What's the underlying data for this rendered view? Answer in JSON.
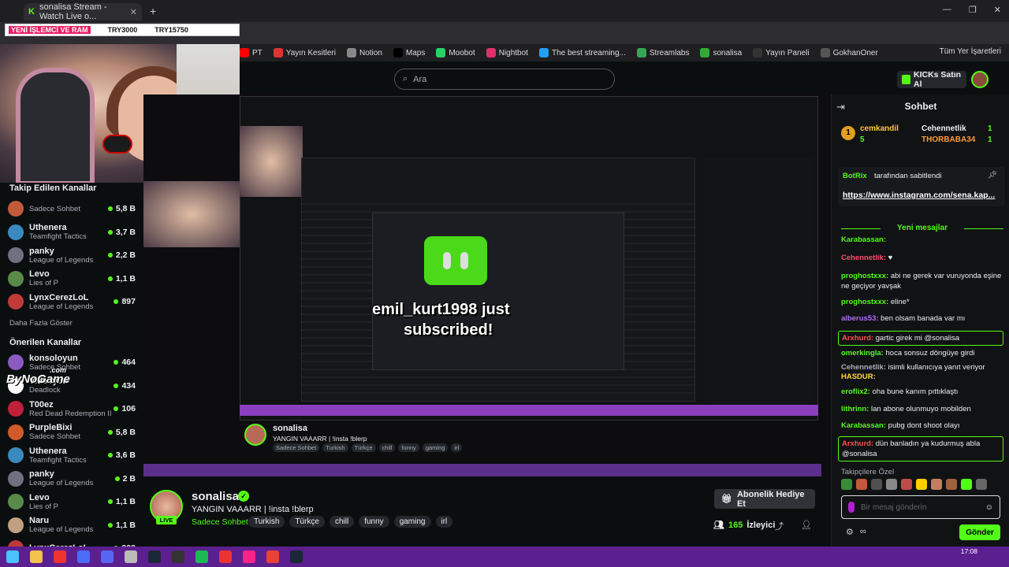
{
  "browser": {
    "tab_title": "sonalisa Stream - Watch Live o...",
    "search_placeholder": "Ara",
    "bookmarks": [
      "PT",
      "Yayın Kesitleri",
      "Notion",
      "Maps",
      "Moobot",
      "Nightbot",
      "The best streaming...",
      "Streamlabs",
      "sonalisa",
      "Yayın Paneli",
      "GokhanOner"
    ],
    "bookmarks_right": "Tüm Yer İşaretleri"
  },
  "overlay": {
    "ticker_highlight": "YENİ İŞLEMCİ VE RAM",
    "ticker_a": "TRY3000",
    "ticker_b": "TRY15750",
    "watermark": "ByNoGame",
    "watermark_small": ".com"
  },
  "header": {
    "ai_button": "KICKs Satın Al"
  },
  "sidebar": {
    "followed_header": "Takip Edilen Kanallar",
    "followed": [
      {
        "name": "",
        "game": "Sadece Sohbet",
        "viewers": "5,8 B",
        "color": "#c05a3a"
      },
      {
        "name": "Uthenera",
        "game": "Teamfight Tactics",
        "viewers": "3,7 B",
        "color": "#3a8ac0"
      },
      {
        "name": "panky",
        "game": "League of Legends",
        "viewers": "2,2 B",
        "color": "#707080"
      },
      {
        "name": "Levo",
        "game": "Lies of P",
        "viewers": "1,1 B",
        "color": "#5a8a4a"
      },
      {
        "name": "LynxCerezLoL",
        "game": "League of Legends",
        "viewers": "897",
        "color": "#c03a3a"
      }
    ],
    "more_link": "Daha Fazla Göster",
    "recommended_header": "Önerilen Kanallar",
    "recommended": [
      {
        "name": "konsoloyun",
        "game": "Sadece Sohbet",
        "viewers": "464",
        "color": "#8a5ac0"
      },
      {
        "name": "Videoyun",
        "game": "Deadlock",
        "viewers": "434",
        "color": "#ffffff"
      },
      {
        "name": "T00ez",
        "game": "Red Dead Redemption II",
        "viewers": "106",
        "color": "#c0203a"
      },
      {
        "name": "PurpleBixi",
        "game": "Sadece Sohbet",
        "viewers": "5,8 B",
        "color": "#d05a2a"
      },
      {
        "name": "Uthenera",
        "game": "Teamfight Tactics",
        "viewers": "3,6 B",
        "color": "#3a8ac0"
      },
      {
        "name": "panky",
        "game": "League of Legends",
        "viewers": "2 B",
        "color": "#707080"
      },
      {
        "name": "Levo",
        "game": "Lies of P",
        "viewers": "1,1 B",
        "color": "#5a8a4a"
      },
      {
        "name": "Naru",
        "game": "League of Legends",
        "viewers": "1,1 B",
        "color": "#c0a080"
      },
      {
        "name": "LynxCerezLoL",
        "game": "",
        "viewers": "903",
        "color": "#c03a3a"
      }
    ]
  },
  "player": {
    "sub_name": "emil_kurt1998 just",
    "sub_text": "subscribed!",
    "inner_name": "sonalisa",
    "inner_title": "YANGIN VAAARR | !insta !blerp",
    "inner_tags": [
      "Sadece Sohbet",
      "Turkish",
      "Türkçe",
      "chill",
      "funny",
      "gaming",
      "irl"
    ]
  },
  "channel": {
    "name": "sonalisa",
    "live": "LIVE",
    "title": "YANGIN VAAARR | !insta !blerp",
    "category": "Sadece Sohbet",
    "tags": [
      "Turkish",
      "Türkçe",
      "chill",
      "funny",
      "gaming",
      "irl"
    ],
    "gift_button": "Abonelik Hediye Et",
    "viewer_count": "165",
    "viewer_label": "İzleyici"
  },
  "chat": {
    "title": "Sohbet",
    "gifters": [
      {
        "rank": "1",
        "name": "cemkandil",
        "count": "5"
      },
      {
        "name": "Cehennetlik",
        "count": "1"
      },
      {
        "name": "THORBABA34",
        "count": "1"
      }
    ],
    "pinned_by": "BotRix",
    "pinned_label": "tarafından sabitlendi",
    "pinned_link": "https://www.instagram.com/sena.kap...",
    "new_messages": "Yeni mesajlar",
    "messages": [
      {
        "user": "Karabassan:",
        "text": "",
        "color": "#53fc18",
        "boxed": false
      },
      {
        "user": "Cehennetlik:",
        "text": "♥",
        "color": "#ff4d6a",
        "boxed": false
      },
      {
        "user": "proghostxxx:",
        "text": "abi ne gerek var vuruyonda eşine ne geçiyor yavşak",
        "color": "#53fc18",
        "boxed": false
      },
      {
        "user": "proghostxxx:",
        "text": "eline*",
        "color": "#53fc18",
        "boxed": false
      },
      {
        "user": "alberus53:",
        "text": "ben olsam banada var mı",
        "color": "#b36bff",
        "boxed": false
      },
      {
        "user": "Arxhurd:",
        "text": "gartic girek mi @sonalisa",
        "color": "#ff4d4d",
        "boxed": true
      },
      {
        "user": "omerkingla:",
        "text": "hoca sonsuz döngüye girdi",
        "color": "#53fc18",
        "boxed": false
      },
      {
        "user": "Cehennetlik:",
        "text": "isimli kullanıcıya yanıt veriyor",
        "color": "#adadb8",
        "boxed": false
      },
      {
        "user": "HASDUR:",
        "text": "",
        "color": "#ffd83b",
        "boxed": false
      },
      {
        "user": "eroflix2:",
        "text": "oha bune kanım pıttıklaştı",
        "color": "#53fc18",
        "boxed": false
      },
      {
        "user": "lithrinn:",
        "text": "lan abone olunmuyo mobilden",
        "color": "#53fc18",
        "boxed": false
      },
      {
        "user": "Karabassan:",
        "text": "pubg dont shoot olayı",
        "color": "#53fc18",
        "boxed": false
      },
      {
        "user": "Arxhurd:",
        "text": "dün banladın ya kudurmuş abla @sonalisa",
        "color": "#ff4d4d",
        "boxed": true
      }
    ],
    "sub_only_label": "Takipçilere Özel",
    "input_placeholder": "Bir mesaj gönderin",
    "send_button": "Gönder"
  },
  "taskbar": {
    "time": "17:08",
    "date": ""
  }
}
